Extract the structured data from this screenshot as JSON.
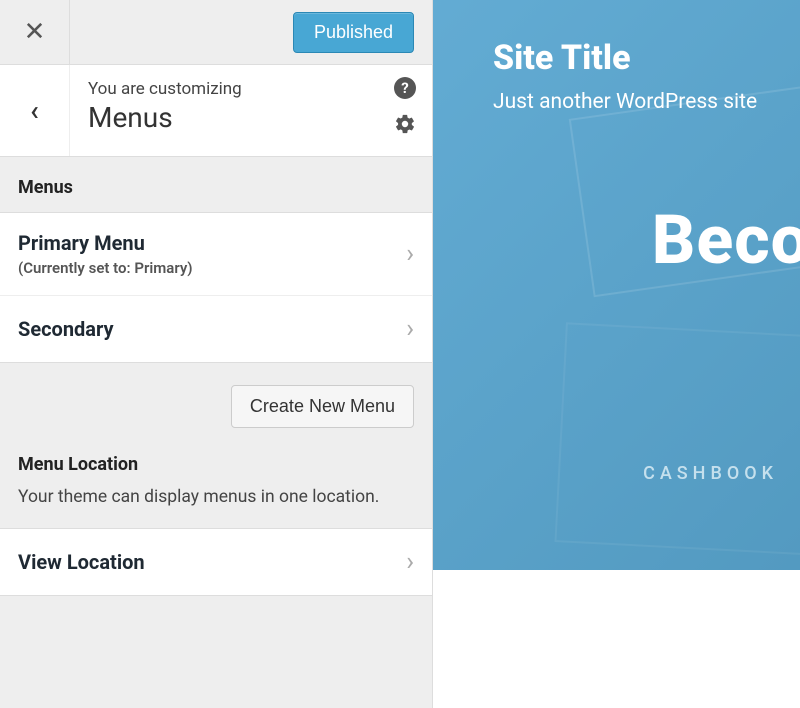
{
  "topbar": {
    "published_label": "Published"
  },
  "header": {
    "customizing_label": "You are customizing",
    "section_title": "Menus"
  },
  "menus": {
    "group_label": "Menus",
    "items": [
      {
        "title": "Primary Menu",
        "sub": "(Currently set to: Primary)"
      },
      {
        "title": "Secondary",
        "sub": ""
      }
    ],
    "create_label": "Create New Menu"
  },
  "location": {
    "group_label": "Menu Location",
    "description": "Your theme can display menus in one location.",
    "view_label": "View Location"
  },
  "preview": {
    "site_title": "Site Title",
    "tagline": "Just another WordPress site",
    "big_word": "Beco",
    "cashbook": "CASHBOOK"
  },
  "icons": {
    "help": "?",
    "gear": "gear-icon",
    "close": "✕",
    "back": "‹",
    "chevron": "›"
  }
}
